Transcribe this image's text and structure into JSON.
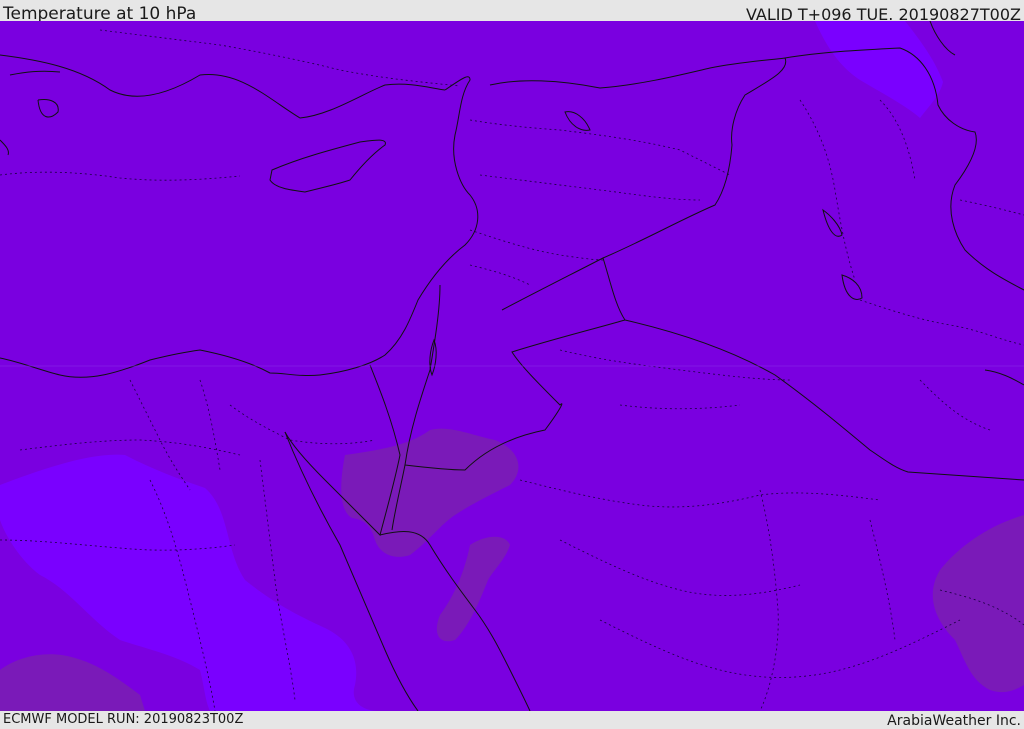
{
  "header": {
    "title": "Temperature at 10 hPa",
    "valid": "VALID T+096 TUE. 20190827T00Z"
  },
  "footer": {
    "model_run": "ECMWF MODEL RUN: 20190823T00Z",
    "credit": "ArabiaWeather Inc."
  },
  "colors": {
    "base_field": "#7a00e0",
    "cold_band": "#7a00ff",
    "warm_patch": "#7a1ab8",
    "outline": "#111111",
    "chrome": "#e6e6e6"
  }
}
